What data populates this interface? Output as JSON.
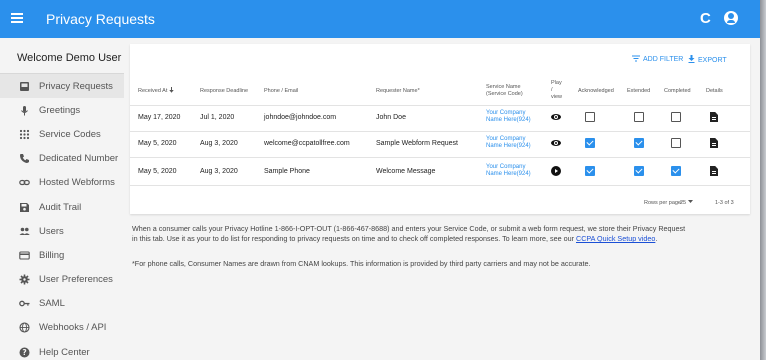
{
  "header": {
    "title": "Privacy Requests",
    "refresh_glyph": "C",
    "icons": [
      "menu-icon",
      "refresh-icon",
      "account-icon"
    ]
  },
  "sidebar": {
    "welcome": "Welcome Demo User",
    "items": [
      {
        "label": "Privacy Requests",
        "icon": "inbox-icon",
        "active": true
      },
      {
        "label": "Greetings",
        "icon": "microphone-icon"
      },
      {
        "label": "Service Codes",
        "icon": "dialpad-icon"
      },
      {
        "label": "Dedicated Number",
        "icon": "phone-icon"
      },
      {
        "label": "Hosted Webforms",
        "icon": "link-icon"
      },
      {
        "label": "Audit Trail",
        "icon": "save-icon"
      },
      {
        "label": "Users",
        "icon": "people-icon"
      },
      {
        "label": "Billing",
        "icon": "credit-card-icon"
      },
      {
        "label": "User Preferences",
        "icon": "gear-icon"
      },
      {
        "label": "SAML",
        "icon": "key-icon"
      },
      {
        "label": "Webhooks / API",
        "icon": "globe-icon"
      },
      {
        "label": "Help Center",
        "icon": "help-icon"
      }
    ]
  },
  "toolbar": {
    "filter_label": "ADD FILTER",
    "export_label": "EXPORT"
  },
  "table": {
    "headers": {
      "received": "Received At",
      "deadline": "Response Deadline",
      "phone": "Phone / Email",
      "requester": "Requester Name*",
      "service_line1": "Service Name",
      "service_line2": "(Service Code)",
      "play_line1": "Play",
      "play_line2": "/",
      "play_line3": "view",
      "ack": "Acknowledged",
      "ext": "Extended",
      "done": "Completed",
      "details": "Details"
    },
    "rows": [
      {
        "received": "May 17, 2020",
        "deadline": "Jul 1, 2020",
        "phone": "johndoe@johndoe.com",
        "requester": "John Doe",
        "service_line1": "Your Company",
        "service_line2": "Name Here(924)",
        "media": "eye-icon",
        "ack": false,
        "ext": false,
        "done": false
      },
      {
        "received": "May 5, 2020",
        "deadline": "Aug 3, 2020",
        "phone": "welcome@ccpatollfree.com",
        "requester": "Sample Webform Request",
        "service_line1": "Your Company",
        "service_line2": "Name Here(924)",
        "media": "eye-icon",
        "ack": true,
        "ext": true,
        "done": false
      },
      {
        "received": "May 5, 2020",
        "deadline": "Aug 3, 2020",
        "phone": "Sample Phone",
        "requester": "Welcome Message",
        "service_line1": "Your Company",
        "service_line2": "Name Here(924)",
        "media": "play-icon",
        "ack": true,
        "ext": true,
        "done": true
      }
    ],
    "rows_per_page_label": "Rows per page:",
    "rows_per_page_value": "25",
    "range": "1-3 of 3"
  },
  "info": {
    "line1_text": "When a consumer calls your Privacy Hotline 1-866-I-OPT-OUT (1-866-467-8688) and enters your Service Code, or submit a web form request, we store their Privacy Request",
    "line2_text": "in this tab. Use it as your to do list for responding to privacy requests on time and to check off completed responses. To learn more, see our",
    "link_text": "CCPA Quick Setup video",
    "line2_end": ".",
    "note": "*For phone calls, Consumer Names are drawn from CNAM lookups. This information is provided by third party carriers and may not be accurate."
  },
  "colors": {
    "accent": "#2b90ec",
    "link": "#1a4fd6"
  }
}
